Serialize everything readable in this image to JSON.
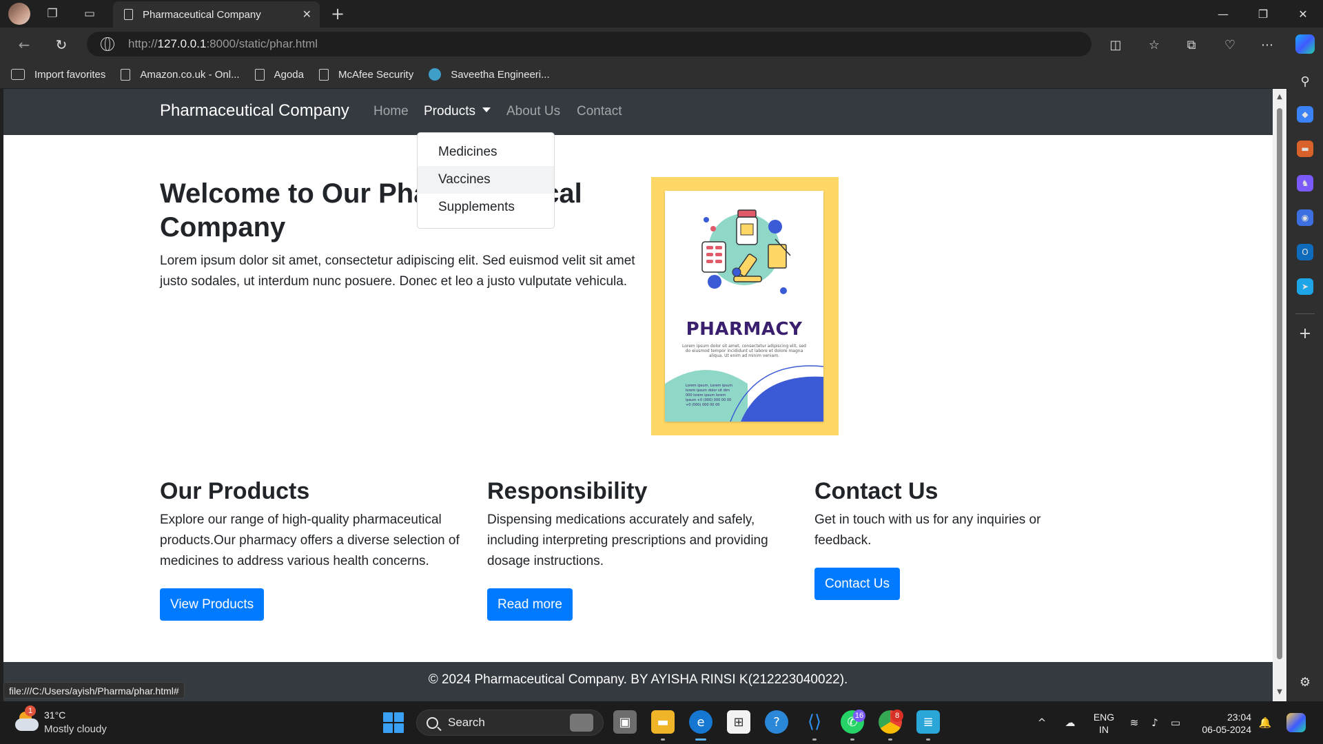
{
  "browser": {
    "tab_title": "Pharmaceutical Company",
    "url_proto": "http://",
    "url_host": "127.0.0.1",
    "url_path": ":8000/static/phar.html",
    "favorites": [
      {
        "label": "Import favorites"
      },
      {
        "label": "Amazon.co.uk - Onl..."
      },
      {
        "label": "Agoda"
      },
      {
        "label": "McAfee Security"
      },
      {
        "label": "Saveetha Engineeri..."
      }
    ],
    "status_url": "file:///C:/Users/ayish/Pharma/phar.html#"
  },
  "site": {
    "brand": "Pharmaceutical Company",
    "nav": {
      "home": "Home",
      "products": "Products",
      "about": "About Us",
      "contact": "Contact"
    },
    "dropdown": [
      "Medicines",
      "Vaccines",
      "Supplements"
    ],
    "hero": {
      "title": "Welcome to Our Pharmaceutical Company",
      "text": "Lorem ipsum dolor sit amet, consectetur adipiscing elit. Sed euismod velit sit amet justo sodales, ut interdum nunc posuere. Donec et leo a justo vulputate vehicula."
    },
    "poster": {
      "title": "PHARMACY",
      "blurb": "Lorem ipsum dolor sit amet, consectetur adipiscing elit, sed do eiusmod tempor incididunt ut labore et dolore magna aliqua. Ut enim ad minim veniam.",
      "foot": "Lorem ipsum, Lorem ipsum lorem ipsum dolor sit dim 000 lorem ipsum lorem ipsum +0 (000) 000 00 00 +0 (000) 000 00 00"
    },
    "sections": [
      {
        "title": "Our Products",
        "text": "Explore our range of high-quality pharmaceutical products.Our pharmacy offers a diverse selection of medicines to address various health concerns.",
        "button": "View Products"
      },
      {
        "title": "Responsibility",
        "text": "Dispensing medications accurately and safely, including interpreting prescriptions and providing dosage instructions.",
        "button": "Read more"
      },
      {
        "title": "Contact Us",
        "text": "Get in touch with us for any inquiries or feedback.",
        "button": "Contact Us"
      }
    ],
    "footer": "© 2024 Pharmaceutical Company. BY AYISHA RINSI K(212223040022)."
  },
  "taskbar": {
    "weather_temp": "31°C",
    "weather_desc": "Mostly cloudy",
    "weather_badge": "1",
    "search_label": "Search",
    "whatsapp_badge": "16",
    "chrome_badge": "8",
    "lang_line1": "ENG",
    "lang_line2": "IN",
    "time": "23:04",
    "date": "06-05-2024"
  },
  "colors": {
    "navbar": "#343a40",
    "primary_button": "#007bff",
    "poster_frame": "#fed766",
    "poster_title": "#3a1f6e"
  }
}
